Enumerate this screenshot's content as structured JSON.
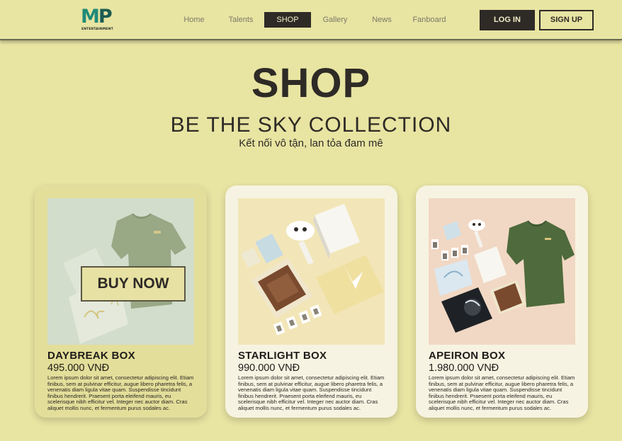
{
  "brand": {
    "logo_mark_left": "M",
    "logo_mark_right": "P",
    "logo_sub": "ENTERTAINMENT"
  },
  "nav": {
    "items": [
      {
        "label": "Home",
        "active": false
      },
      {
        "label": "Talents",
        "active": false
      },
      {
        "label": "SHOP",
        "active": true
      },
      {
        "label": "Gallery",
        "active": false
      },
      {
        "label": "News",
        "active": false
      },
      {
        "label": "Fanboard",
        "active": false
      }
    ],
    "login_label": "LOG IN",
    "signup_label": "SIGN UP"
  },
  "hero": {
    "title": "SHOP",
    "subtitle": "BE THE SKY COLLECTION",
    "tagline": "Kết nối vô tận, lan tỏa đam mê"
  },
  "products": [
    {
      "name": "DAYBREAK BOX",
      "price": "495.000 VNĐ",
      "buy_label": "BUY NOW",
      "description": "Lorem ipsum dolor sit amet, consectetur adipiscing elit. Etiam finibus, sem at pulvinar efficitur, augue libero pharetra felis, a venenatis diam ligula vitae quam. Suspendisse tincidunt finibus hendrerit. Praesent porta eleifend mauris, eu scelerisque nibh efficitur vel. Integer nec auctor diam. Cras aliquet mollis nunc, et fermentum purus sodales ac."
    },
    {
      "name": "STARLIGHT BOX",
      "price": "990.000 VNĐ",
      "description": "Lorem ipsum dolor sit amet, consectetur adipiscing elit. Etiam finibus, sem at pulvinar efficitur, augue libero pharetra felis, a venenatis diam ligula vitae quam. Suspendisse tincidunt finibus hendrerit. Praesent porta eleifend mauris, eu scelerisque nibh efficitur vel. Integer nec auctor diam. Cras aliquet mollis nunc, et fermentum purus sodales ac."
    },
    {
      "name": "APEIRON BOX",
      "price": "1.980.000 VNĐ",
      "description": "Lorem ipsum dolor sit amet, consectetur adipiscing elit. Etiam finibus, sem at pulvinar efficitur, augue libero pharetra felis, a venenatis diam ligula vitae quam. Suspendisse tincidunt finibus hendrerit. Praesent porta eleifend mauris, eu scelerisque nibh efficitur vel. Integer nec auctor diam. Cras aliquet mollis nunc, et fermentum purus sodales ac."
    }
  ],
  "colors": {
    "background": "#e8e4a2",
    "dark": "#2e2a26",
    "brand_teal": "#1f8a78",
    "card_light": "#f7f3e2"
  }
}
